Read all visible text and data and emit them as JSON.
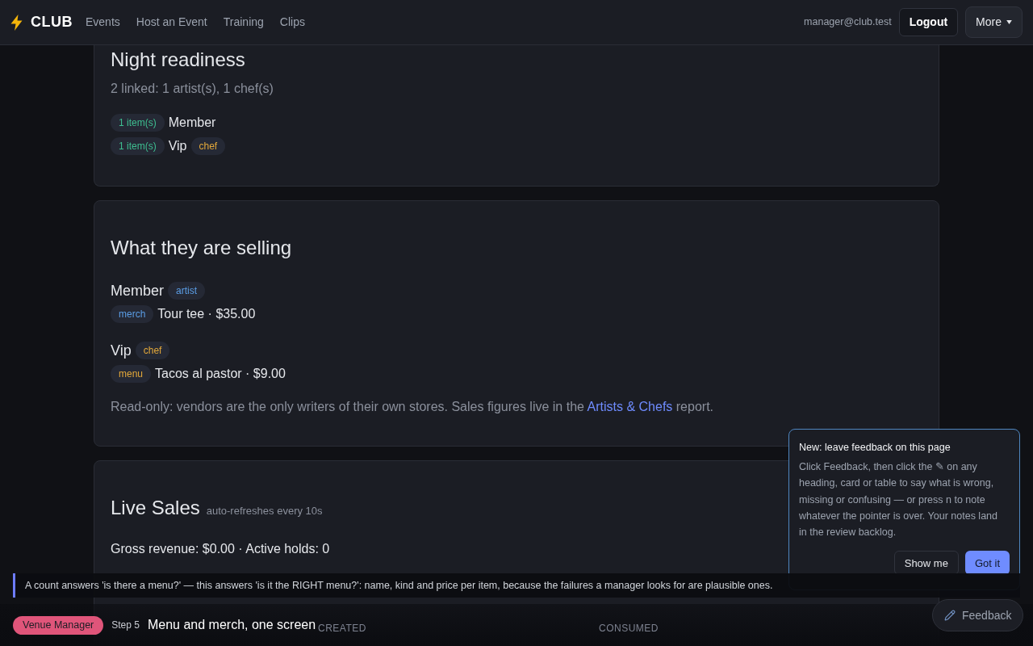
{
  "nav": {
    "brand": "CLUB",
    "links": [
      {
        "label": "Events"
      },
      {
        "label": "Host an Event"
      },
      {
        "label": "Training"
      },
      {
        "label": "Clips"
      }
    ],
    "user": "manager@club.test",
    "logout": "Logout",
    "more": "More"
  },
  "readiness": {
    "title": "Night readiness",
    "summary": "2 linked: 1 artist(s), 1 chef(s)",
    "rows": [
      {
        "count": "1 item(s)",
        "name": "Member"
      },
      {
        "count": "1 item(s)",
        "name": "Vip",
        "tag": {
          "label": "chef",
          "color": "#e3a83a"
        }
      }
    ]
  },
  "selling": {
    "title": "What they are selling",
    "vendors": [
      {
        "name": "Member",
        "tag": {
          "label": "artist",
          "color": "#5b9ee6"
        },
        "items": [
          {
            "kind": "merch",
            "color": "#5b9ee6",
            "text": "Tour tee · $35.00"
          }
        ]
      },
      {
        "name": "Vip",
        "tag": {
          "label": "chef",
          "color": "#e3a83a"
        },
        "items": [
          {
            "kind": "menu",
            "color": "#e3a83a",
            "text": "Tacos al pastor · $9.00"
          }
        ]
      }
    ],
    "note": "Read-only: vendors are the only writers of their own stores. Sales figures live in the ",
    "link": "Artists & Chefs",
    "note_end": " report."
  },
  "live_sales": {
    "title": "Live Sales",
    "subtitle": "auto-refreshes every 10s",
    "summary": "Gross revenue: $0.00 · Active holds: 0",
    "columns": [
      "CREATED",
      "CONSUMED"
    ]
  },
  "tip": "A count answers 'is there a menu?' — this answers 'is it the RIGHT menu?': name, kind and price per item, because the failures a manager looks for are plausible ones.",
  "tour": {
    "role": "Venue Manager",
    "step": "Step 5",
    "title": "Menu and merch, one screen"
  },
  "popover": {
    "title": "New: leave feedback on this page",
    "body": "Click Feedback, then click the ✎ on any heading, card or table to say what is wrong, missing or confusing — or press n to note whatever the pointer is over. Your notes land in the review backlog.",
    "buttons": [
      {
        "label": "Show me",
        "kind": "secondary"
      },
      {
        "label": "Got it",
        "kind": "primary"
      }
    ]
  },
  "feedback_button": "Feedback"
}
